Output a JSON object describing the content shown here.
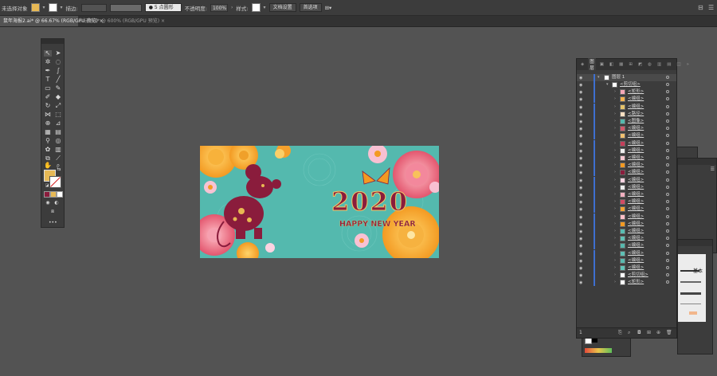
{
  "control_bar": {
    "selection_label": "未选择对象",
    "stroke_label": "描边:",
    "brush_label": "5 点圆形",
    "opacity_label": "不透明度:",
    "opacity_value": "100%",
    "style_label": "样式:",
    "doc_settings_label": "文档设置",
    "preferences_label": "首选项"
  },
  "tabs": [
    {
      "label": "鼠年海报2.ai* @ 66.67% (RGB/GPU 预览)",
      "active": true
    },
    {
      "label": "未标题-1* @ 600% (RGB/GPU 预览)",
      "active": false
    }
  ],
  "artwork": {
    "year": "2020",
    "greeting": "HAPPY NEW YEAR"
  },
  "layers_panel": {
    "tabs": [
      "图层"
    ],
    "layer_count": "1",
    "top_layer": "图层 1",
    "rows": [
      {
        "name": "<剪切组>",
        "depth": 1
      },
      {
        "name": "<矩形>",
        "depth": 2
      },
      {
        "name": "<编组>",
        "depth": 2
      },
      {
        "name": "<编组>",
        "depth": 2
      },
      {
        "name": "<路径>",
        "depth": 2
      },
      {
        "name": "<图像>",
        "depth": 2
      },
      {
        "name": "<编组>",
        "depth": 2
      },
      {
        "name": "<编组>",
        "depth": 2
      },
      {
        "name": "<编组>",
        "depth": 2
      },
      {
        "name": "<编组>",
        "depth": 2
      },
      {
        "name": "<编组>",
        "depth": 2
      },
      {
        "name": "<编组>",
        "depth": 2
      },
      {
        "name": "<编组>",
        "depth": 2
      },
      {
        "name": "<编组>",
        "depth": 2
      },
      {
        "name": "<编组>",
        "depth": 2
      },
      {
        "name": "<编组>",
        "depth": 2
      },
      {
        "name": "<编组>",
        "depth": 2
      },
      {
        "name": "<编组>",
        "depth": 2
      },
      {
        "name": "<编组>",
        "depth": 2
      },
      {
        "name": "<编组>",
        "depth": 2
      },
      {
        "name": "<编组>",
        "depth": 2
      },
      {
        "name": "<编组>",
        "depth": 2
      },
      {
        "name": "<编组>",
        "depth": 2
      },
      {
        "name": "<编组>",
        "depth": 2
      },
      {
        "name": "<编组>",
        "depth": 2
      },
      {
        "name": "<编组>",
        "depth": 2
      },
      {
        "name": "<剪切组>",
        "depth": 2
      },
      {
        "name": "<矩形>",
        "depth": 2
      }
    ]
  },
  "brush_panel": {
    "label": "基本"
  },
  "colors": {
    "artboard_bg": "#54b9ae",
    "fill": "#e7b955",
    "title_red": "#8a1c3c",
    "layer_blue": "#3e6fd0"
  }
}
